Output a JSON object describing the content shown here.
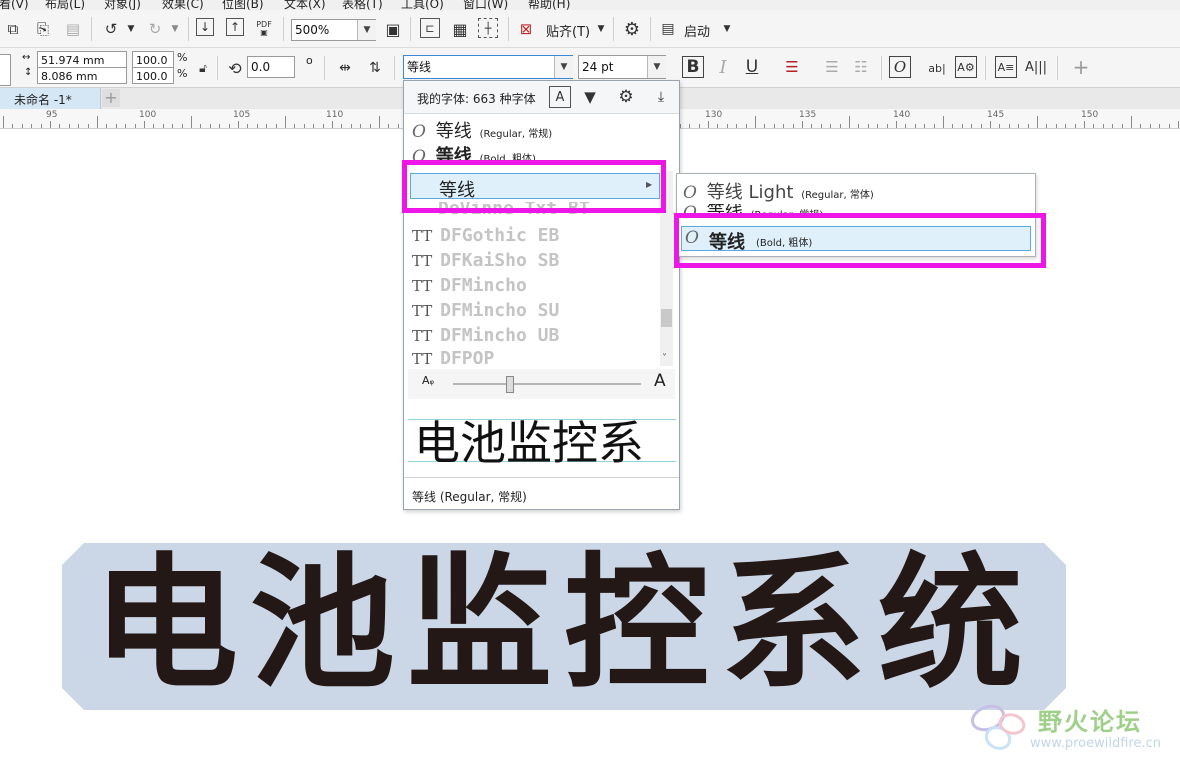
{
  "menu": [
    "看(V)",
    "布局(L)",
    "对象(J)",
    "效果(C)",
    "位图(B)",
    "文本(X)",
    "表格(T)",
    "工具(O)",
    "窗口(W)",
    "帮助(H)"
  ],
  "toolbar": {
    "zoom_value": "500%",
    "snap_label": "贴齐(T)",
    "launch_label": "启动",
    "pdf_label": "PDF"
  },
  "property_bar": {
    "width": "51.974 mm",
    "height": "8.086 mm",
    "scale_x": "100.0",
    "scale_y": "100.0",
    "percent": "%",
    "rotation": "0.0",
    "degree": "o",
    "font_name": "等线",
    "font_size": "24 pt",
    "bold": "B",
    "italic": "I",
    "underline": "U",
    "plus": "+"
  },
  "document_tab": {
    "name": "未命名 -1*",
    "add": "+"
  },
  "ruler": {
    "labels": [
      "95",
      "100",
      "105",
      "110",
      "130",
      "135",
      "140",
      "145",
      "150"
    ]
  },
  "font_panel": {
    "header": "我的字体: 663 种字体",
    "entries": [
      {
        "name": "等线",
        "style": "(Regular, 常规)",
        "bold": false
      },
      {
        "name": "等线",
        "style": "(Bold, 粗体)",
        "bold": true
      }
    ],
    "family_item": "等线",
    "cut_item": "DeVinne Txt BT",
    "grey_fonts": [
      "DFGothic EB",
      "DFKaiSho SB",
      "DFMincho",
      "DFMincho SU",
      "DFMincho UB",
      "DFPOP"
    ],
    "preview_text": "电池监控系",
    "footer": "等线 (Regular, 常规)"
  },
  "submenu": {
    "items": [
      {
        "name": "等线 Light",
        "style": "(Regular, 常体)"
      },
      {
        "name": "等线",
        "style": "(Regular, 常规)"
      },
      {
        "name": "等线",
        "style": "(Bold, 粗体)"
      }
    ]
  },
  "canvas": {
    "text": "电池监控系统"
  },
  "watermark": {
    "title": "野火论坛",
    "url": "www.proewildfire.cn"
  },
  "colors": {
    "highlight": "#ee16e6",
    "selection": "#dff0fb",
    "banner": "#cbd7e6",
    "text": "#231815"
  }
}
